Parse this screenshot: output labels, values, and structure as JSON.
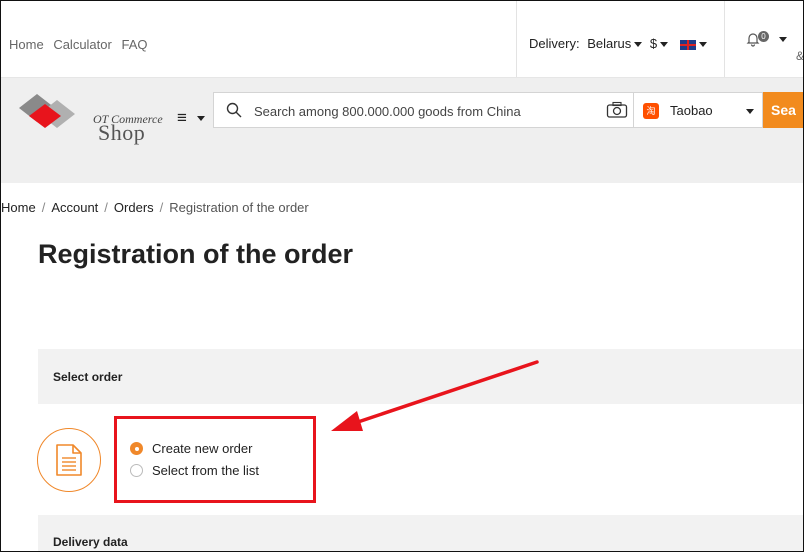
{
  "topbar": {
    "links": [
      "Home",
      "Calculator",
      "FAQ"
    ],
    "delivery_label": "Delivery:",
    "delivery_country": "Belarus",
    "currency": "$",
    "notifications_count": "0"
  },
  "header": {
    "logo_sub": "OT Commerce",
    "logo_main": "Shop",
    "search_placeholder": "Search among 800.000.000 goods from China",
    "provider_logo": "淘",
    "provider": "Taobao",
    "search_button": "Sea"
  },
  "breadcrumb": [
    "Home",
    "Account",
    "Orders",
    "Registration of the order"
  ],
  "page_title": "Registration of the order",
  "sections": {
    "select_order": "Select order",
    "delivery_data": "Delivery data"
  },
  "options": {
    "create_new": "Create new order",
    "select_list": "Select from the list",
    "selected": "create_new"
  },
  "colors": {
    "accent": "#f0882a",
    "search_button": "#f28b1e",
    "annotation_red": "#e8141c"
  }
}
